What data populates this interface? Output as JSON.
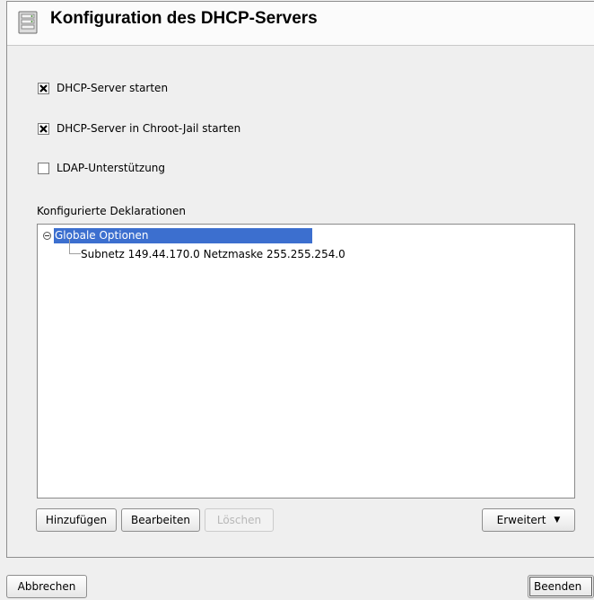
{
  "header": {
    "title": "Konfiguration des DHCP-Servers",
    "icon": "server-config-icon"
  },
  "options": {
    "start_server": {
      "label": "DHCP-Server starten",
      "checked": true
    },
    "chroot_jail": {
      "label": "DHCP-Server in Chroot-Jail starten",
      "checked": true
    },
    "ldap": {
      "label": "LDAP-Unterstützung",
      "checked": false
    }
  },
  "declarations": {
    "label": "Konfigurierte Deklarationen",
    "root": {
      "label": "Globale Optionen",
      "expanded": true,
      "selected": true
    },
    "children": [
      {
        "label": "Subnetz 149.44.170.0 Netzmaske 255.255.254.0"
      }
    ]
  },
  "buttons": {
    "add": "Hinzufügen",
    "edit": "Bearbeiten",
    "delete": "Löschen",
    "advanced": "Erweitert",
    "cancel": "Abbrechen",
    "finish": "Beenden"
  },
  "colors": {
    "selection": "#3c6fcf"
  }
}
